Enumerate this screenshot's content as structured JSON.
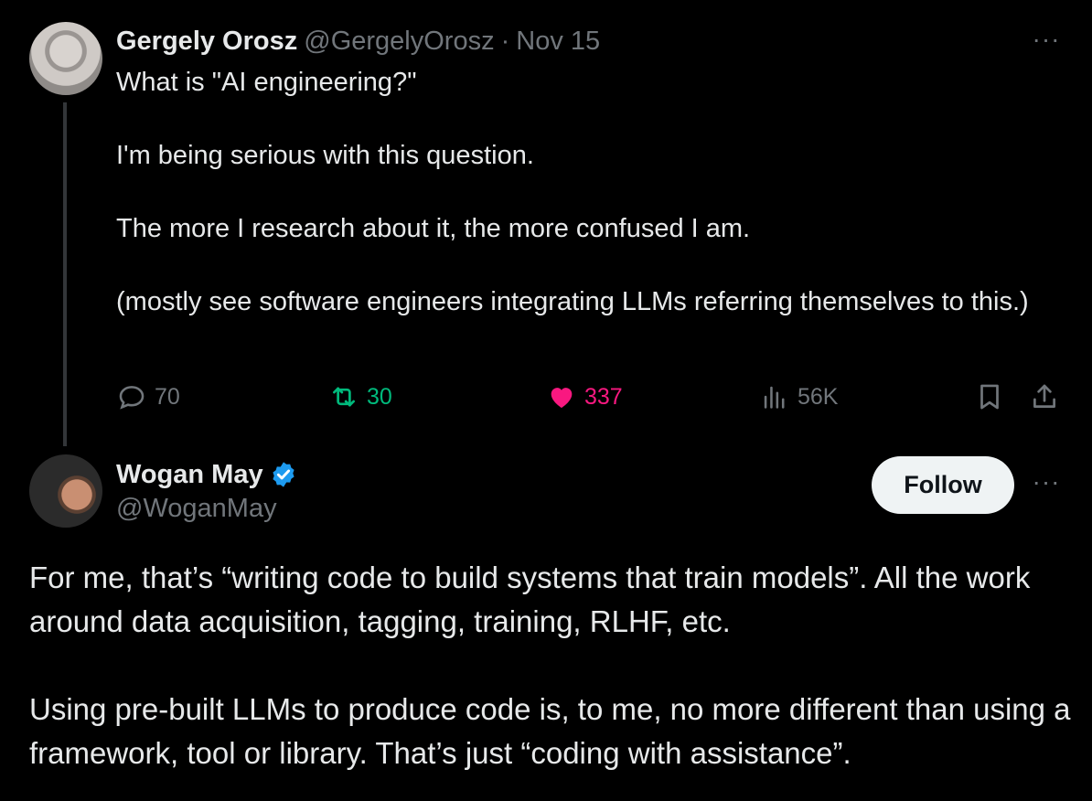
{
  "tweet1": {
    "name": "Gergely Orosz",
    "handle": "@GergelyOrosz",
    "separator": "·",
    "date": "Nov 15",
    "more": "···",
    "lines": [
      "What is \"AI engineering?\"",
      "",
      "I'm being serious with this question.",
      "",
      "The more I research about it, the more confused I am.",
      "",
      "(mostly see software engineers integrating LLMs referring themselves to this.)"
    ],
    "stats": {
      "replies": "70",
      "reposts": "30",
      "likes": "337",
      "views": "56K"
    }
  },
  "tweet2": {
    "name": "Wogan May",
    "handle": "@WoganMay",
    "verified": true,
    "follow_label": "Follow",
    "more": "···",
    "paragraph1": "For me, that’s “writing code to build systems that train models”. All the work around data acquisition, tagging, training, RLHF, etc.",
    "paragraph2": "Using pre-built LLMs to produce code is, to me, no more different than using a framework, tool or library. That’s just “coding with assistance”."
  },
  "colors": {
    "background": "#000000",
    "text": "#e7e9ea",
    "secondary": "#71767b",
    "repost": "#00ba7c",
    "like": "#f91880",
    "verified": "#1d9bf0",
    "follow_bg": "#eff3f4"
  },
  "icons": [
    "reply-icon",
    "repost-icon",
    "heart-icon",
    "views-icon",
    "bookmark-icon",
    "share-icon",
    "verified-badge-icon",
    "more-icon"
  ]
}
